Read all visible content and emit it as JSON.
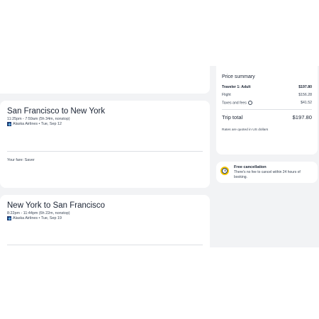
{
  "legs": [
    {
      "title": "San Francisco to New York",
      "time": "11:25pm - 7:59am (5h 34m, nonstop)",
      "airline": "Alaska Airlines • Tue, Sep 12",
      "fare": "Your fare: Saver"
    },
    {
      "title": "New York to San Francisco",
      "time": "8:22pm - 11:44pm (6h 22m, nonstop)",
      "airline": "Alaska Airlines • Tue, Sep 19"
    }
  ],
  "price_summary": {
    "title": "Price summary",
    "traveler_label": "Traveler 1: Adult",
    "traveler_value": "$197.80",
    "flight_label": "Flight",
    "flight_value": "$156.28",
    "taxes_label": "Taxes and fees",
    "taxes_value": "$41.52",
    "total_label": "Trip total",
    "total_value": "$197.80",
    "note": "Rates are quoted in US dollars"
  },
  "cancellation": {
    "title": "Free cancellation",
    "text": "There's no fee to cancel within 24 hours of booking."
  }
}
